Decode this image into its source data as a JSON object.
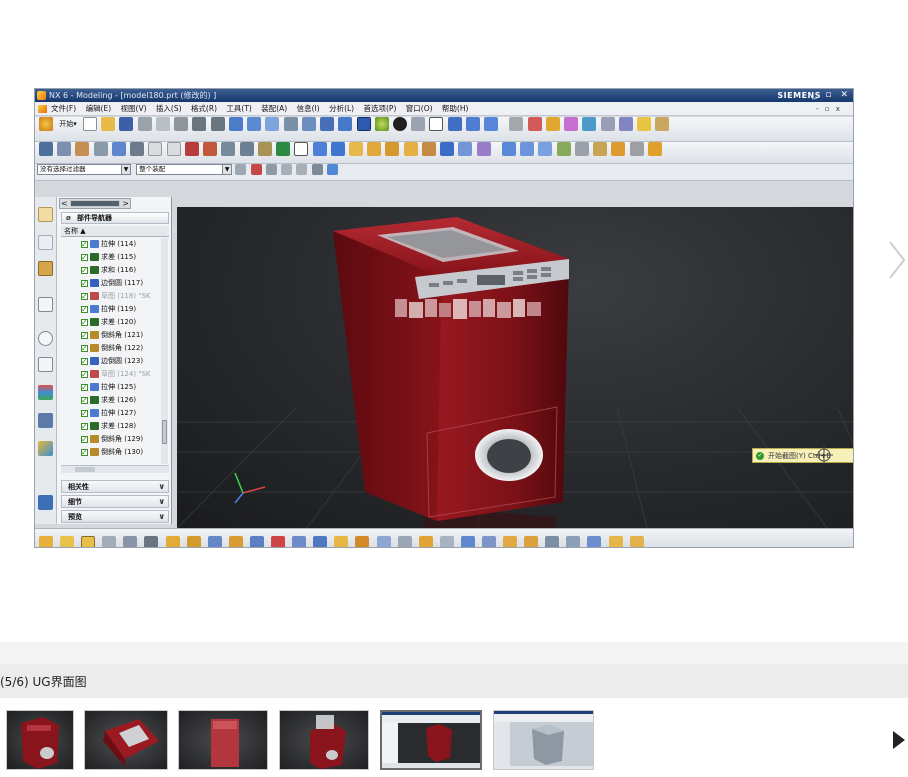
{
  "app": {
    "title": "NX 6 - Modeling - [model180.prt  (修改的) ]",
    "brand": "SIEMENS",
    "window_buttons": "_ ▫ ✕",
    "menus": [
      "文件(F)",
      "编辑(E)",
      "视图(V)",
      "插入(S)",
      "格式(R)",
      "工具(T)",
      "装配(A)",
      "信息(I)",
      "分析(L)",
      "首选项(P)",
      "窗口(O)",
      "帮助(H)"
    ],
    "start_label": "开始▾",
    "filter_combo": "没有选择过滤器",
    "assembly_combo": "整个装配"
  },
  "navigator": {
    "title": "部件导航器",
    "column": "名称  ▲",
    "items": [
      {
        "label": "拉伸 (114)",
        "icon": "extrude-icon",
        "color": "#4a7bd0",
        "dim": false
      },
      {
        "label": "求差 (115)",
        "icon": "subtract-icon",
        "color": "#2a6a2a",
        "dim": false
      },
      {
        "label": "求和 (116)",
        "icon": "unite-icon",
        "color": "#2a6a2a",
        "dim": false
      },
      {
        "label": "边倒圆 (117)",
        "icon": "edge-blend-icon",
        "color": "#3561c0",
        "dim": false
      },
      {
        "label": "草图 (118) \"SK",
        "icon": "sketch-icon",
        "color": "#c04a4a",
        "dim": true
      },
      {
        "label": "拉伸 (119)",
        "icon": "extrude-icon",
        "color": "#4a7bd0",
        "dim": false
      },
      {
        "label": "求差 (120)",
        "icon": "subtract-icon",
        "color": "#2a6a2a",
        "dim": false
      },
      {
        "label": "倒斜角 (121)",
        "icon": "chamfer-icon",
        "color": "#b88a2a",
        "dim": false
      },
      {
        "label": "倒斜角 (122)",
        "icon": "chamfer-icon",
        "color": "#b88a2a",
        "dim": false
      },
      {
        "label": "边倒圆 (123)",
        "icon": "edge-blend-icon",
        "color": "#3561c0",
        "dim": false
      },
      {
        "label": "草图 (124) \"SK",
        "icon": "sketch-icon",
        "color": "#c04a4a",
        "dim": true
      },
      {
        "label": "拉伸 (125)",
        "icon": "extrude-icon",
        "color": "#4a7bd0",
        "dim": false
      },
      {
        "label": "求差 (126)",
        "icon": "subtract-icon",
        "color": "#2a6a2a",
        "dim": false
      },
      {
        "label": "拉伸 (127)",
        "icon": "extrude-icon",
        "color": "#4a7bd0",
        "dim": false
      },
      {
        "label": "求差 (128)",
        "icon": "subtract-icon",
        "color": "#2a6a2a",
        "dim": false
      },
      {
        "label": "倒斜角 (129)",
        "icon": "chamfer-icon",
        "color": "#b88a2a",
        "dim": false
      },
      {
        "label": "倒斜角 (130)",
        "icon": "chamfer-icon",
        "color": "#b88a2a",
        "dim": false
      }
    ],
    "sections": [
      "相关性",
      "细节",
      "预览"
    ]
  },
  "viewport": {
    "tooltip": "开始截图(Y)  Ctrl+B",
    "model_color": "#8e1218"
  },
  "gallery": {
    "caption": "(5/6) UG界面图",
    "current": 5,
    "total": 6,
    "thumbnails": [
      {
        "name": "thumb-1",
        "active": false
      },
      {
        "name": "thumb-2",
        "active": false
      },
      {
        "name": "thumb-3",
        "active": false
      },
      {
        "name": "thumb-4",
        "active": false
      },
      {
        "name": "thumb-5",
        "active": true
      },
      {
        "name": "thumb-6",
        "active": false
      }
    ]
  },
  "colors": {
    "caption_bar": "#ececec",
    "titlebar": "#16376b",
    "viewport_bg": "#27292c"
  }
}
